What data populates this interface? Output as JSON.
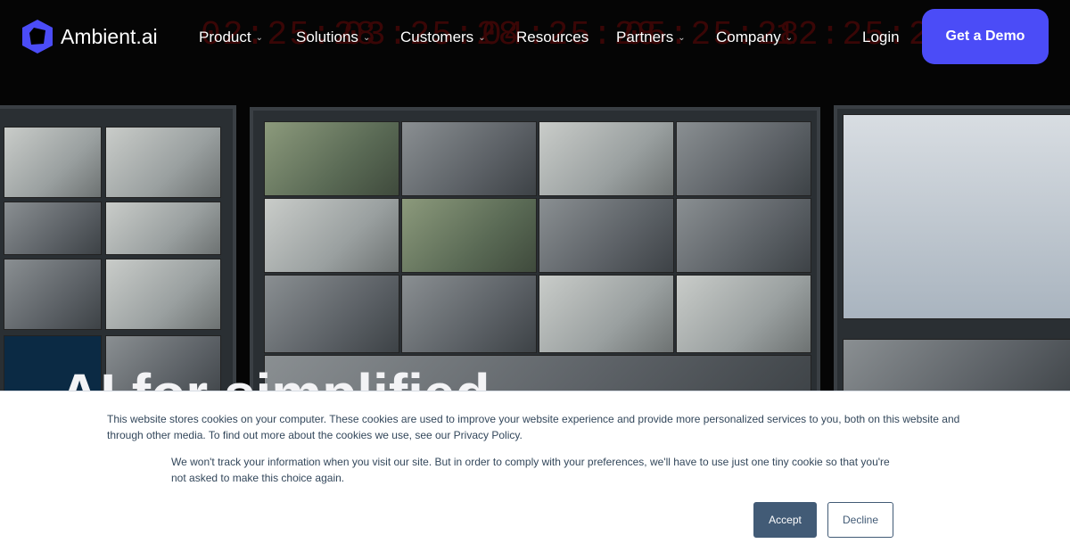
{
  "brand": {
    "name": "Ambient.ai",
    "logo_color": "#4b4cf7"
  },
  "nav": {
    "items": [
      {
        "label": "Product",
        "dropdown": true
      },
      {
        "label": "Solutions",
        "dropdown": true
      },
      {
        "label": "Customers",
        "dropdown": true
      },
      {
        "label": "Resources",
        "dropdown": false
      },
      {
        "label": "Partners",
        "dropdown": true
      },
      {
        "label": "Company",
        "dropdown": true
      }
    ],
    "login": "Login",
    "cta": "Get a Demo",
    "cta_color": "#4b4cf7"
  },
  "hero": {
    "headline": "AI for simplified"
  },
  "cookie": {
    "text1": "This website stores cookies on your computer. These cookies are used to improve your website experience and provide more personalized services to you, both on this website and through other media. To find out more about the cookies we use, see our Privacy Policy.",
    "text2": "We won't track your information when you visit our site. But in order to comply with your preferences, we'll have to use just one tiny cookie so that you're not asked to make this choice again.",
    "accept": "Accept",
    "decline": "Decline"
  }
}
